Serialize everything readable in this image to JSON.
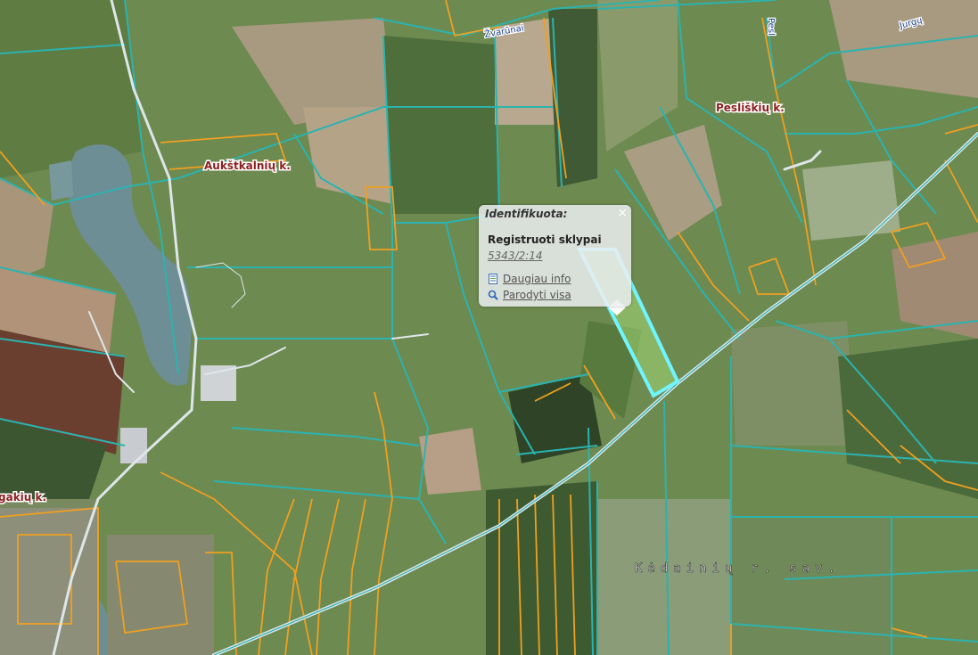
{
  "map": {
    "places": [
      {
        "name": "Aukštkalnių k.",
        "key": "aukstkalniu"
      },
      {
        "name": "Pesliškių k.",
        "key": "pesliskiu"
      },
      {
        "name": "gakių k.",
        "key": "gakiu"
      }
    ],
    "roads": [
      "Žvarūnai",
      "Pesl",
      "Jurgų"
    ],
    "region_label": "Kėdainių r. sav."
  },
  "popup": {
    "title": "Identifikuota:",
    "layer": "Registruoti sklypai",
    "parcel_id": "5343/2:14",
    "links": [
      {
        "label": "Daugiau info",
        "icon": "document-info-icon"
      },
      {
        "label": "Parodyti visa",
        "icon": "magnifier-icon"
      }
    ],
    "close_symbol": "×"
  },
  "colors": {
    "parcel_boundary": "#2bb3b0",
    "ownership_boundary": "#f0a020",
    "road": "#dfe6ea",
    "selected_parcel": "#6ff5ff"
  }
}
